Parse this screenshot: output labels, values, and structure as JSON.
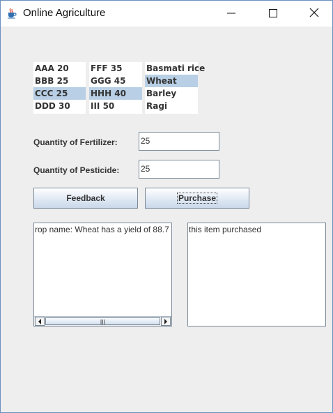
{
  "window": {
    "title": "Online Agriculture",
    "icon": "java-cup-icon"
  },
  "lists": {
    "list1": [
      "AAA 20",
      "BBB 25",
      "CCC 25",
      "DDD 30"
    ],
    "list2": [
      "FFF 35",
      "GGG 45",
      "HHH 40",
      "III 50"
    ],
    "list3": [
      "Basmati rice",
      "Wheat",
      "Barley",
      "Ragi"
    ],
    "selection_color": "#b8cfe5"
  },
  "form": {
    "fertilizer_label": "Quantity of Fertilizer:",
    "fertilizer_value": "25",
    "pesticide_label": "Quantity of Pesticide:",
    "pesticide_value": "25"
  },
  "buttons": {
    "feedback_label": "Feedback",
    "purchase_label": "Purchase"
  },
  "output": {
    "left_text": "rop name: Wheat has a yield of 88.7",
    "right_text": "this item purchased"
  }
}
